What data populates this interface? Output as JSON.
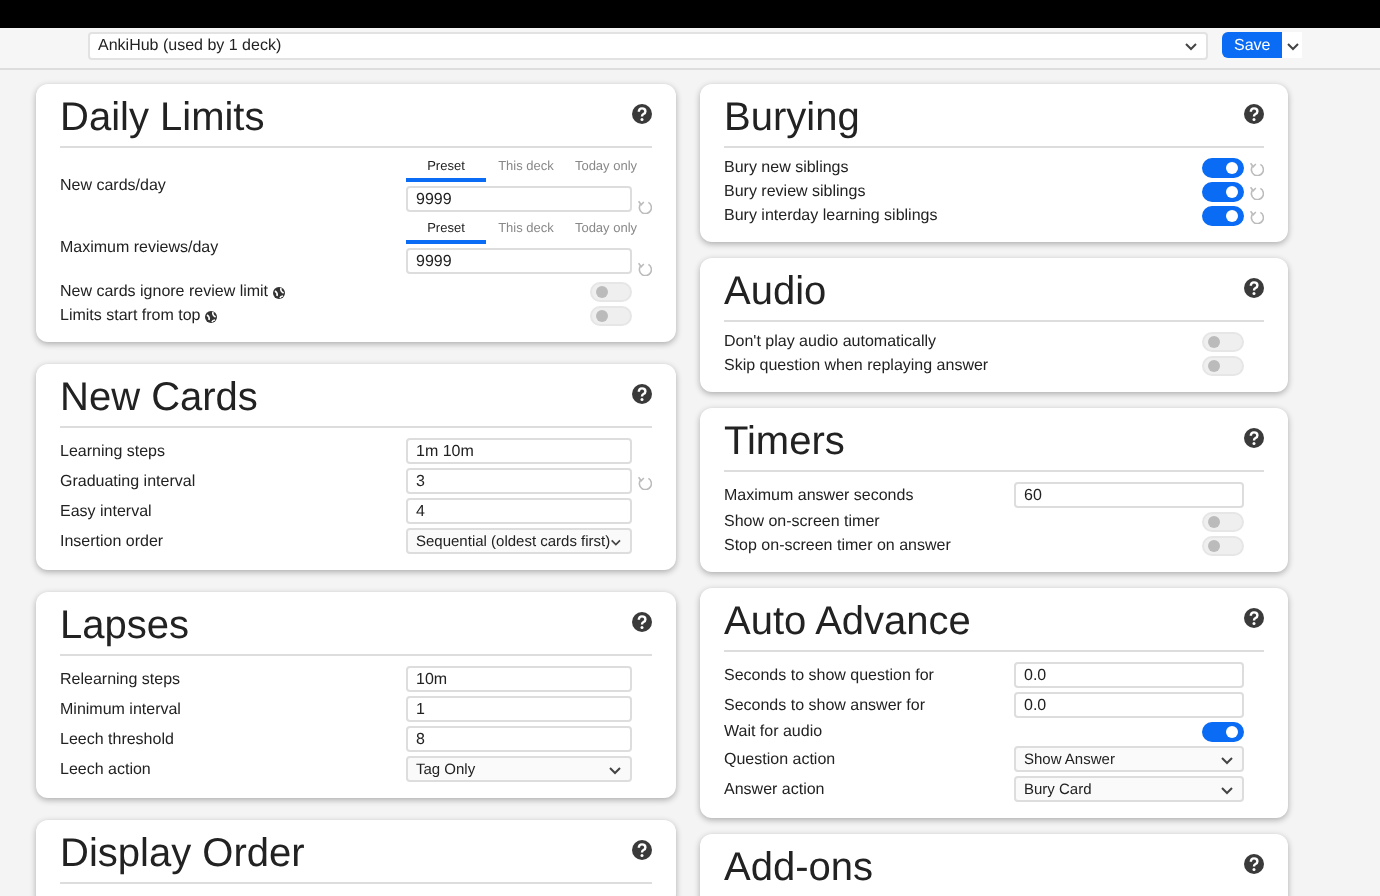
{
  "preset_select": {
    "value": "AnkiHub (used by 1 deck)"
  },
  "save_button": {
    "label": "Save"
  },
  "columns": [
    [
      {
        "title": "Daily Limits",
        "rows": [
          {
            "kind": "limit",
            "label": "New cards/day",
            "tabs": [
              {
                "label": "Preset",
                "selected": true
              },
              {
                "label": "This deck",
                "selected": false
              },
              {
                "label": "Today only",
                "selected": false
              }
            ],
            "value": "9999",
            "revert": true
          },
          {
            "kind": "limit",
            "label": "Maximum reviews/day",
            "tabs": [
              {
                "label": "Preset",
                "selected": true
              },
              {
                "label": "This deck",
                "selected": false
              },
              {
                "label": "Today only",
                "selected": false
              }
            ],
            "value": "9999",
            "revert": true
          },
          {
            "kind": "toggle",
            "label": "New cards ignore review limit",
            "on": false,
            "global": true
          },
          {
            "kind": "toggle",
            "label": "Limits start from top",
            "on": false,
            "global": true
          }
        ]
      },
      {
        "title": "New Cards",
        "rows": [
          {
            "kind": "input",
            "label": "Learning steps",
            "value": "1m 10m"
          },
          {
            "kind": "input",
            "label": "Graduating interval",
            "value": "3",
            "revert": true
          },
          {
            "kind": "input",
            "label": "Easy interval",
            "value": "4"
          },
          {
            "kind": "select",
            "label": "Insertion order",
            "value": "Sequential (oldest cards first)"
          }
        ]
      },
      {
        "title": "Lapses",
        "rows": [
          {
            "kind": "input",
            "label": "Relearning steps",
            "value": "10m"
          },
          {
            "kind": "input",
            "label": "Minimum interval",
            "value": "1"
          },
          {
            "kind": "input",
            "label": "Leech threshold",
            "value": "8"
          },
          {
            "kind": "select",
            "label": "Leech action",
            "value": "Tag Only"
          }
        ]
      },
      {
        "title": "Display Order"
      }
    ],
    [
      {
        "title": "Burying",
        "rows": [
          {
            "kind": "toggle",
            "label": "Bury new siblings",
            "on": true,
            "revert": true
          },
          {
            "kind": "toggle",
            "label": "Bury review siblings",
            "on": true,
            "revert": true
          },
          {
            "kind": "toggle",
            "label": "Bury interday learning siblings",
            "on": true,
            "revert": true
          }
        ]
      },
      {
        "title": "Audio",
        "rows": [
          {
            "kind": "toggle",
            "label": "Don't play audio automatically",
            "on": false
          },
          {
            "kind": "toggle",
            "label": "Skip question when replaying answer",
            "on": false
          }
        ]
      },
      {
        "title": "Timers",
        "rows": [
          {
            "kind": "input",
            "label": "Maximum answer seconds",
            "value": "60"
          },
          {
            "kind": "toggle",
            "label": "Show on-screen timer",
            "on": false
          },
          {
            "kind": "toggle",
            "label": "Stop on-screen timer on answer",
            "on": false
          }
        ]
      },
      {
        "title": "Auto Advance",
        "rows": [
          {
            "kind": "input",
            "label": "Seconds to show question for",
            "value": "0.0"
          },
          {
            "kind": "input",
            "label": "Seconds to show answer for",
            "value": "0.0"
          },
          {
            "kind": "toggle",
            "label": "Wait for audio",
            "on": true
          },
          {
            "kind": "select",
            "label": "Question action",
            "value": "Show Answer"
          },
          {
            "kind": "select",
            "label": "Answer action",
            "value": "Bury Card"
          }
        ]
      },
      {
        "title": "Add-ons"
      }
    ]
  ]
}
